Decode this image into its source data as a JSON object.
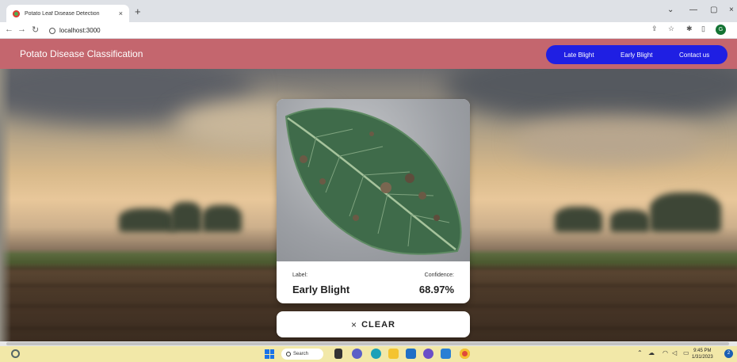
{
  "browser": {
    "tab_title": "Potato Leaf Disease Detection",
    "tab_close": "×",
    "new_tab": "+",
    "url": "localhost:3000",
    "profile_initial": "G",
    "window_minimize": "⌄",
    "window_restore": "—",
    "window_max": "▢",
    "window_close": "×"
  },
  "app": {
    "title": "Potato Disease Classification",
    "nav": [
      "Late Blight",
      "Early Blight",
      "Contact us"
    ],
    "header_color": "#c4666e",
    "nav_color": "#1f1fe3"
  },
  "result": {
    "label_heading": "Label:",
    "label_value": "Early Blight",
    "confidence_heading": "Confidence:",
    "confidence_value": "68.97%"
  },
  "clear_button": {
    "icon": "×",
    "label": "CLEAR"
  },
  "taskbar": {
    "search_label": "Search",
    "time": "9:45 PM",
    "date": "1/31/2023",
    "notification_count": "2"
  }
}
